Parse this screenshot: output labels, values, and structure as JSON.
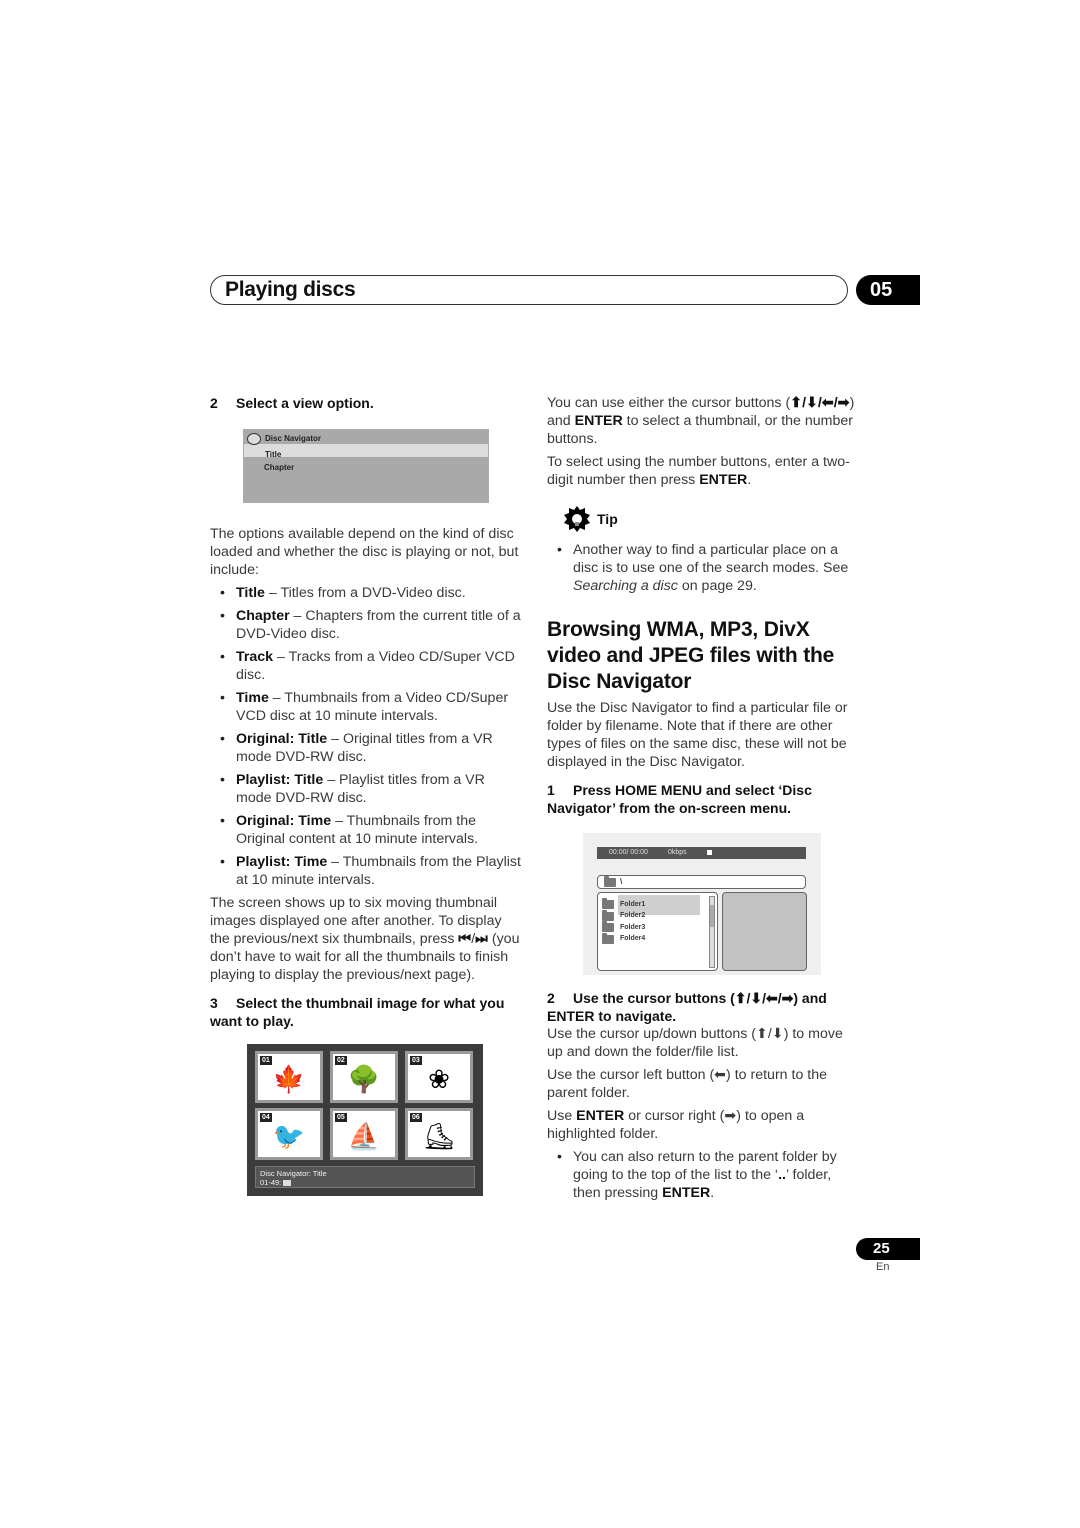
{
  "header": {
    "title": "Playing discs",
    "chapter_number": "05"
  },
  "left_column": {
    "step2_number": "2",
    "step2_title": "Select a view option.",
    "view_menu": {
      "title": "Disc Navigator",
      "items": [
        {
          "label": "Title",
          "selected": true
        },
        {
          "label": "Chapter",
          "selected": false
        }
      ]
    },
    "intro": "The options available depend on the kind of disc loaded and whether the disc is playing or not, but include:",
    "options": [
      {
        "term": "Title",
        "desc": " – Titles from a DVD-Video disc."
      },
      {
        "term": "Chapter",
        "desc": " – Chapters from the current title of a DVD-Video disc."
      },
      {
        "term": "Track",
        "desc": " – Tracks from a Video CD/Super VCD disc."
      },
      {
        "term": "Time",
        "desc": " – Thumbnails from a Video CD/Super VCD disc at 10 minute intervals."
      },
      {
        "term": "Original: Title",
        "desc": " – Original titles from a VR mode DVD-RW disc."
      },
      {
        "term": "Playlist: Title",
        "desc": " – Playlist titles from a VR mode DVD-RW disc."
      },
      {
        "term": "Original: Time",
        "desc": " – Thumbnails from the Original content at 10 minute intervals."
      },
      {
        "term": "Playlist: Time",
        "desc": " – Thumbnails from the Playlist at 10 minute intervals."
      }
    ],
    "thumbs_para_a": "The screen shows up to six moving thumbnail images displayed one after another. To display the previous/next six thumbnails, press ",
    "thumbs_para_prev": "⏮",
    "thumbs_para_sep": "/",
    "thumbs_para_next": "⏭",
    "thumbs_para_b": " (you don’t have to wait for all the thumbnails to finish playing to display the previous/next page).",
    "step3_number": "3",
    "step3_title": "Select the thumbnail image for what you want to play.",
    "thumbnail_screen": {
      "thumbnails": [
        {
          "number": "01",
          "icon": "leaf",
          "glyph": "🍁"
        },
        {
          "number": "02",
          "icon": "tree",
          "glyph": "🌳"
        },
        {
          "number": "03",
          "icon": "lily-flower",
          "glyph": "❀"
        },
        {
          "number": "04",
          "icon": "toucan-bird",
          "glyph": "🐦"
        },
        {
          "number": "05",
          "icon": "windsurfer",
          "glyph": "⛵"
        },
        {
          "number": "06",
          "icon": "rollerblader",
          "glyph": "⛸"
        }
      ],
      "status_line1": "Disc Navigator: Title",
      "status_line2": "01-49:"
    }
  },
  "right_column": {
    "cursor_para_a": "You can use either the cursor buttons (",
    "cursor_arrows": "⬆/⬇/⬅/➡",
    "cursor_para_b": ") and ",
    "cursor_enter": "ENTER",
    "cursor_para_c": " to select a thumbnail, or the number buttons.",
    "number_para_a": "To select using the number buttons, enter a two-digit number then press ",
    "number_enter": "ENTER",
    "number_para_b": ".",
    "tip": {
      "label": "Tip",
      "text_a": "Another way to find a particular place on a disc is to use one of the search modes. See ",
      "text_ref": "Searching a disc",
      "text_b": " on page 29."
    },
    "section_title": "Browsing WMA, MP3, DivX video and JPEG files with the Disc Navigator",
    "section_intro": "Use the Disc Navigator to find a particular file or folder by filename. Note that if there are other types of files on the same disc, these will not be displayed in the Disc Navigator.",
    "step1_number": "1",
    "step1_title": "Press HOME MENU and select ‘Disc Navigator’ from the on-screen menu.",
    "navigator_screen": {
      "time": "00:00/ 00:00",
      "bitrate": "0kbps",
      "path": "\\",
      "folders": [
        {
          "name": "Folder1",
          "selected": true
        },
        {
          "name": "Folder2",
          "selected": false
        },
        {
          "name": "Folder3",
          "selected": false
        },
        {
          "name": "Folder4",
          "selected": false
        }
      ]
    },
    "step2_number": "2",
    "step2_title": "Use the cursor buttons (⬆/⬇/⬅/➡) and ENTER to navigate.",
    "updown_para": "Use the cursor up/down buttons (⬆/⬇) to move up and down the folder/file list.",
    "left_para": "Use the cursor left button (⬅) to return to the parent folder.",
    "enter_para_a": "Use ",
    "enter_para_enter": "ENTER",
    "enter_para_b": " or cursor right (➡) to open a highlighted folder.",
    "bullet_a": "You can also return to the parent folder by going to the top of the list to the ‘",
    "bullet_dots": "..",
    "bullet_b": "’ folder, then pressing ",
    "bullet_enter": "ENTER",
    "bullet_c": "."
  },
  "footer": {
    "page_number": "25",
    "language": "En"
  }
}
